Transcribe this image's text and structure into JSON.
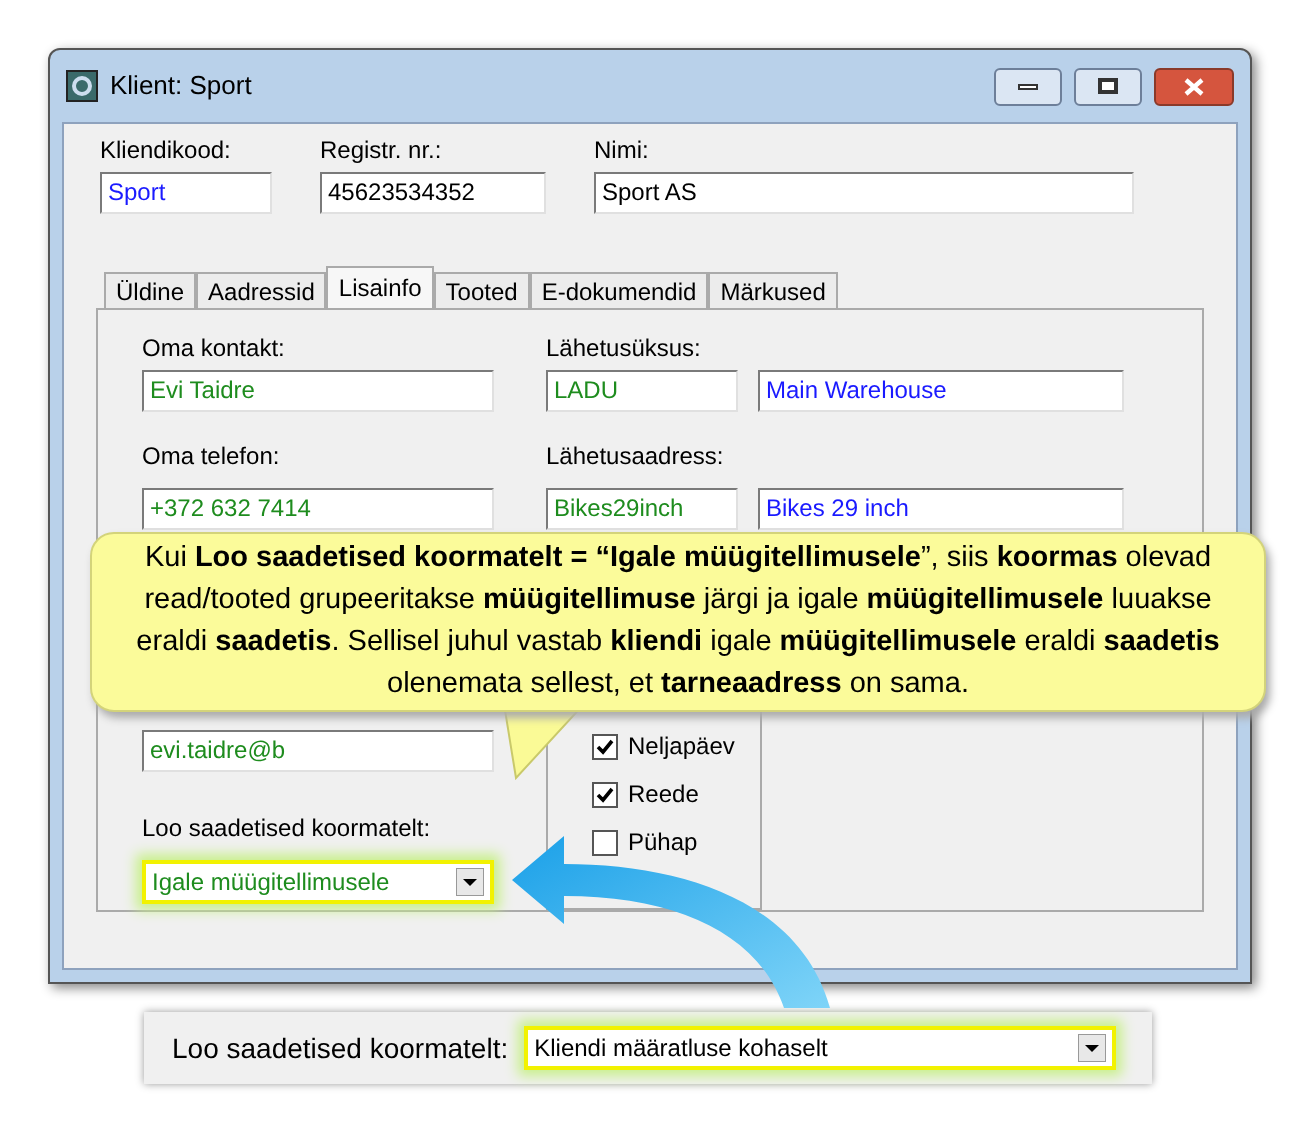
{
  "window": {
    "title": "Klient: Sport"
  },
  "header_fields": [
    {
      "label": "Kliendikood:",
      "value": "Sport",
      "color": "#1a1aff"
    },
    {
      "label": "Registr. nr.:",
      "value": "45623534352",
      "color": "#000000"
    },
    {
      "label": "Nimi:",
      "value": "Sport AS",
      "color": "#000000"
    }
  ],
  "tabs": [
    {
      "label": "Üldine",
      "selected": false
    },
    {
      "label": "Aadressid",
      "selected": false
    },
    {
      "label": "Lisainfo",
      "selected": true
    },
    {
      "label": "Tooted",
      "selected": false
    },
    {
      "label": "E-dokumendid",
      "selected": false
    },
    {
      "label": "Märkused",
      "selected": false
    }
  ],
  "panel": {
    "contact": {
      "label": "Oma kontakt:",
      "value": "Evi Taidre"
    },
    "phone": {
      "label": "Oma telefon:",
      "value": "+372 632 7414"
    },
    "email": {
      "value": "evi.taidre@b"
    },
    "dispatch_unit": {
      "label": "Lähetusüksus:",
      "code": "LADU",
      "name": "Main Warehouse"
    },
    "dispatch_address": {
      "label": "Lähetusaadress:",
      "code": "Bikes29inch",
      "name": "Bikes 29 inch"
    },
    "days": [
      {
        "label": "Neljapäev",
        "checked": true
      },
      {
        "label": "Reede",
        "checked": true
      },
      {
        "label": "Pühap",
        "checked": false
      }
    ],
    "shipments_from_loads": {
      "label": "Loo saadetised koormatelt:",
      "value": "Igale müügitellimusele",
      "highlighted": true
    }
  },
  "callout": {
    "text": "Kui **Loo saadetised koormatelt = “Igale müügitellimusele**”, siis **koormas** olevad read/tooted grupeeritakse **müügitellimuse** järgi ja igale **müügitellimusele** luuakse eraldi **saadetis**. Sellisel juhul vastab **kliendi** igale **müügitellimusele** eraldi **saadetis** olenemata sellest, et **tarneaadress** on sama."
  },
  "alternative": {
    "label": "Loo saadetised koormatelt:",
    "value": "Kliendi määratluse kohaselt",
    "highlighted": true
  }
}
